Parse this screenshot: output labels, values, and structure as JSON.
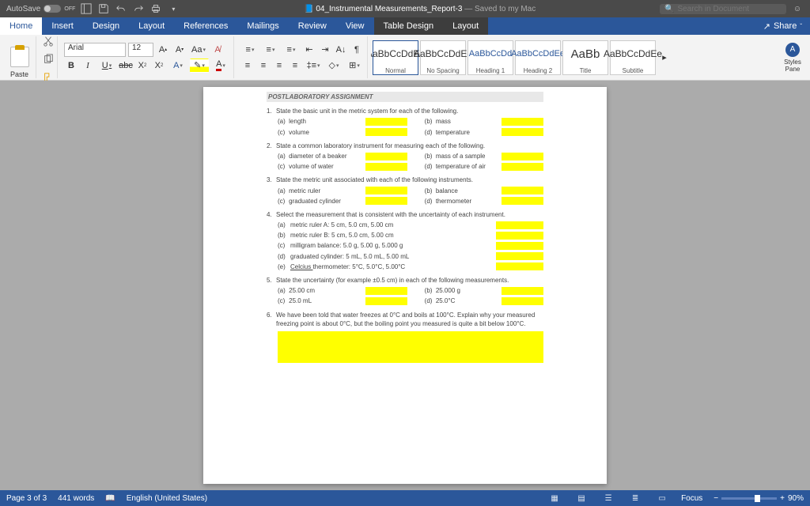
{
  "titlebar": {
    "autosave_label": "AutoSave",
    "autosave_state": "OFF",
    "doc_icon": "W",
    "title": "04_Instrumental Measurements_Report-3",
    "saved": " — Saved to my Mac",
    "search_placeholder": "Search in Document"
  },
  "tabs": {
    "items": [
      "Home",
      "Insert",
      "Design",
      "Layout",
      "References",
      "Mailings",
      "Review",
      "View",
      "Table Design",
      "Layout"
    ],
    "active_index": 0,
    "contextual_start": 8,
    "share_label": "Share"
  },
  "ribbon": {
    "paste_label": "Paste",
    "font_name": "Arial",
    "font_size": "12",
    "styles": [
      {
        "preview": "AaBbCcDdEe",
        "label": "Normal",
        "class": "",
        "selected": true
      },
      {
        "preview": "AaBbCcDdEe",
        "label": "No Spacing",
        "class": ""
      },
      {
        "preview": "AaBbCcDd",
        "label": "Heading 1",
        "class": "h1"
      },
      {
        "preview": "AaBbCcDdEe",
        "label": "Heading 2",
        "class": "h1"
      },
      {
        "preview": "AaBb",
        "label": "Title",
        "class": "title"
      },
      {
        "preview": "AaBbCcDdEe",
        "label": "Subtitle",
        "class": ""
      }
    ],
    "styles_pane_label": "Styles Pane"
  },
  "document": {
    "heading": "POSTLABORATORY ASSIGNMENT",
    "q1": {
      "num": "1.",
      "text": "State the basic unit in the metric system for each of the following.",
      "a": "(a)",
      "a_name": "length",
      "b": "(b)",
      "b_name": "mass",
      "c": "(c)",
      "c_name": "volume",
      "d": "(d)",
      "d_name": "temperature"
    },
    "q2": {
      "num": "2.",
      "text": "State a common laboratory instrument for measuring each of the following.",
      "a": "(a)",
      "a_name": "diameter of a beaker",
      "b": "(b)",
      "b_name": "mass of a sample",
      "c": "(c)",
      "c_name": "volume of water",
      "d": "(d)",
      "d_name": "temperature of air"
    },
    "q3": {
      "num": "3.",
      "text": "State the metric unit associated with each of the following instruments.",
      "a": "(a)",
      "a_name": "metric ruler",
      "b": "(b)",
      "b_name": "balance",
      "c": "(c)",
      "c_name": "graduated cylinder",
      "d": "(d)",
      "d_name": "thermometer"
    },
    "q4": {
      "num": "4.",
      "text": "Select the measurement that is consistent with the uncertainty of each instrument.",
      "a": "(a)",
      "a_name": "metric ruler A:  5 cm, 5.0 cm, 5.00 cm",
      "b": "(b)",
      "b_name": "metric ruler B:  5 cm, 5.0 cm, 5.00 cm",
      "c": "(c)",
      "c_name": "milligram balance:  5.0 g, 5.00 g, 5.000 g",
      "d": "(d)",
      "d_name": "graduated cylinder:  5 mL, 5.0 mL, 5.00 mL",
      "e": "(e)",
      "e_name_pre": "Celcius ",
      "e_name_post": "thermometer:  5°C, 5.0°C, 5.00°C"
    },
    "q5": {
      "num": "5.",
      "text": "State the uncertainty (for example ±0.5 cm) in each of the following measurements.",
      "a": "(a)",
      "a_name": "25.00 cm",
      "b": "(b)",
      "b_name": "25.000 g",
      "c": "(c)",
      "c_name": "25.0 mL",
      "d": "(d)",
      "d_name": "25.0°C"
    },
    "q6": {
      "num": "6.",
      "text": "We have been told that water freezes at 0°C and boils at 100°C. Explain why your measured freezing point is about 0°C, but the boiling point you measured is quite a bit below 100°C."
    }
  },
  "status": {
    "page": "Page 3 of 3",
    "words": "441 words",
    "lang": "English (United States)",
    "focus": "Focus",
    "zoom": "90%"
  }
}
